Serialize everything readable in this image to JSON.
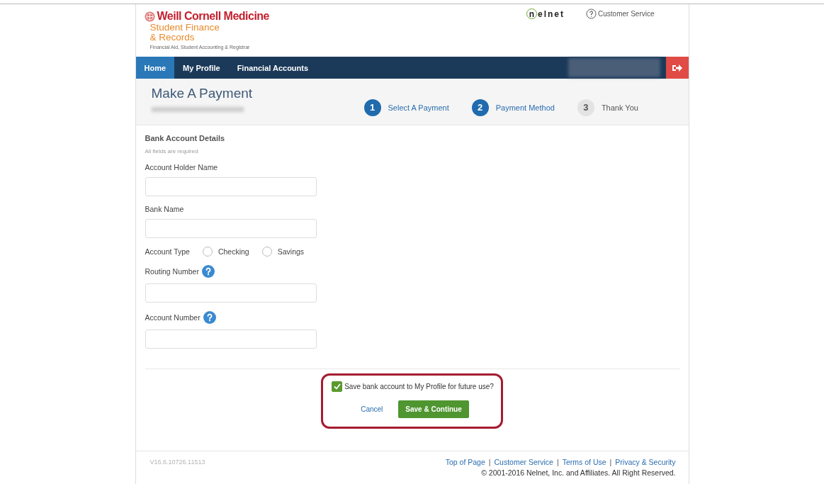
{
  "header": {
    "brand": "Weill Cornell Medicine",
    "subbrand_lines": [
      "Student Finance",
      "& Records"
    ],
    "tagline": "Financial Aid, Student Accounting & Registrar",
    "partner_logo": {
      "mark": "n",
      "text": "elnet"
    },
    "help_link": "Customer Service"
  },
  "nav": {
    "items": [
      {
        "label": "Home",
        "selected": true
      },
      {
        "label": "My Profile",
        "selected": false
      },
      {
        "label": "Financial Accounts",
        "selected": false
      }
    ]
  },
  "page": {
    "title": "Make A Payment",
    "steps": [
      {
        "number": "1",
        "label": "Select A Payment",
        "active": true
      },
      {
        "number": "2",
        "label": "Payment Method",
        "active": true
      },
      {
        "number": "3",
        "label": "Thank You",
        "active": false
      }
    ]
  },
  "form": {
    "heading": "Bank Account Details",
    "note": "All fields are required",
    "fields": [
      {
        "kind": "text",
        "label": "Account Holder Name",
        "help": false
      },
      {
        "kind": "text",
        "label": "Bank Name",
        "help": false
      },
      {
        "kind": "radio",
        "label": "Account Type",
        "options": [
          {
            "label": "Checking",
            "selected": false
          },
          {
            "label": "Savings",
            "selected": false
          }
        ]
      },
      {
        "kind": "text",
        "label": "Routing Number",
        "help": true
      },
      {
        "kind": "text",
        "label": "Account Number",
        "help": true
      }
    ]
  },
  "save_option": {
    "label": "Save bank account to My Profile for future use?",
    "checked": true
  },
  "actions": {
    "cancel": "Cancel",
    "submit": "Save & Continue"
  },
  "footer": {
    "version": "V16.6.10726.11513",
    "links": [
      "Top of Page",
      "Customer Service",
      "Terms of Use",
      "Privacy & Security"
    ],
    "separators": [
      "|",
      "|",
      "|"
    ],
    "copyright": "© 2001-2016 Nelnet, Inc. and Affiliates. All Right Reserved."
  }
}
